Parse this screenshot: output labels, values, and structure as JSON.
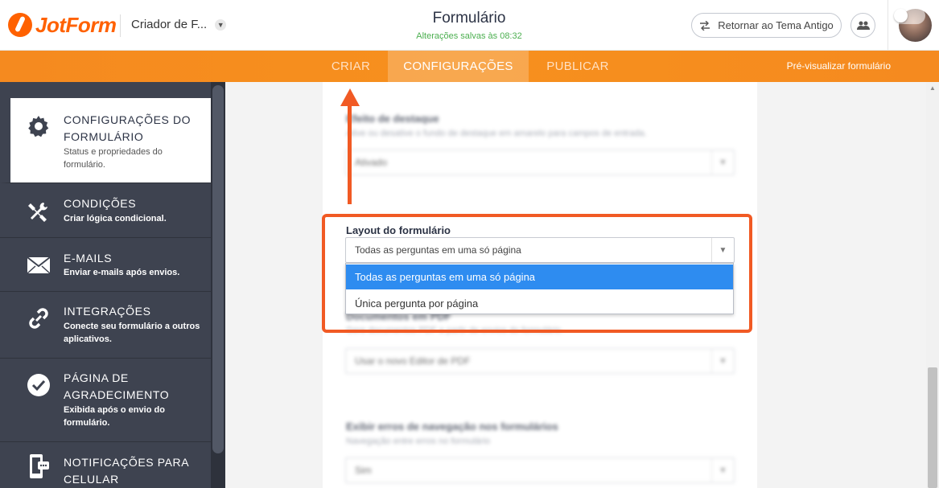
{
  "header": {
    "logo_text": "JotForm",
    "creator_label": "Criador de F...",
    "title": "Formulário",
    "saved_note": "Alterações salvas às 08:32",
    "revert_label": "Retornar ao Tema Antigo"
  },
  "nav": {
    "tabs": [
      {
        "label": "CRIAR",
        "active": false
      },
      {
        "label": "CONFIGURAÇÕES",
        "active": true
      },
      {
        "label": "PUBLICAR",
        "active": false
      }
    ],
    "preview_label": "Pré-visualizar formulário",
    "preview_toggle_on": false
  },
  "sidebar": {
    "items": [
      {
        "title_line1": "CONFIGURAÇÕES DO",
        "title_line2": "FORMULÁRIO",
        "desc_line1": "Status e propriedades do",
        "desc_line2": "formulário.",
        "icon": "gear-icon",
        "active": true
      },
      {
        "title_line1": "CONDIÇÕES",
        "desc_line1": "Criar lógica condicional.",
        "icon": "tools-icon"
      },
      {
        "title_line1": "E-MAILS",
        "desc_line1": "Enviar e-mails após envios.",
        "icon": "envelope-icon"
      },
      {
        "title_line1": "INTEGRAÇÕES",
        "desc_line1": "Conecte seu formulário a outros",
        "desc_line2": "aplicativos.",
        "icon": "link-icon"
      },
      {
        "title_line1": "PÁGINA DE",
        "title_line2": "AGRADECIMENTO",
        "desc_line1": "Exibida após o envio do",
        "desc_line2": "formulário.",
        "icon": "checkmark-icon"
      },
      {
        "title_line1": "NOTIFICAÇÕES PARA",
        "title_line2": "CELULAR",
        "icon": "mobile-icon"
      }
    ]
  },
  "main": {
    "blurred_field1": {
      "label": "Efeito de destaque",
      "sub": "Ative ou desative o fundo de destaque em amarelo para campos de entrada.",
      "value": "Ativado"
    },
    "layout_field": {
      "label": "Layout do formulário",
      "value": "Todas as perguntas em uma só página",
      "options": [
        "Todas as perguntas em uma só página",
        "Única pergunta por página"
      ],
      "selected_index": 0
    },
    "blurred_field2": {
      "label": "Documentos em PDF",
      "sub": "Gere documentos PDF a partir de envios do formulário.",
      "value": "Usar o novo Editor de PDF"
    },
    "blurred_field3": {
      "label": "Exibir erros de navegação nos formulários",
      "sub": "Navegação entre erros no formulário",
      "value": "Sim"
    }
  },
  "colors": {
    "brand_orange": "#f7901e",
    "annotation_red": "#f15a24",
    "selected_blue": "#2e8cf0",
    "sidebar_bg": "#3e4350"
  }
}
